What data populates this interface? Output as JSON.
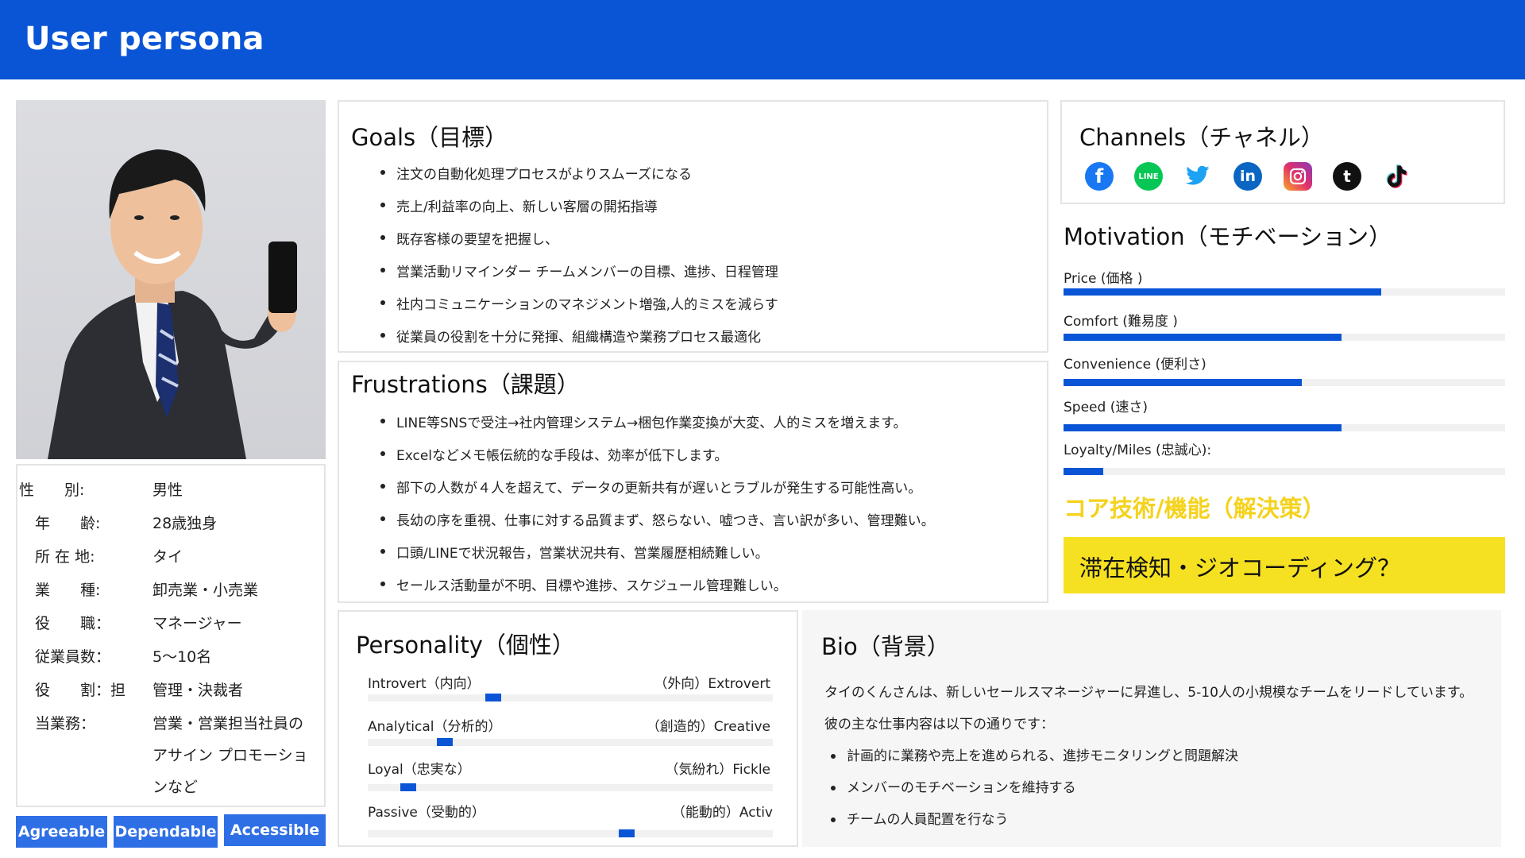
{
  "header": {
    "title": "User persona"
  },
  "profile": {
    "rows": [
      {
        "label": "性　　別:",
        "value": "男性"
      },
      {
        "label": "年　　齢:",
        "value": "28歳独身"
      },
      {
        "label": "所 在 地:",
        "value": "タイ"
      },
      {
        "label": "業　　種:",
        "value": "卸売業・小売業"
      },
      {
        "label": "役　　職：",
        "value": "マネージャー"
      },
      {
        "label": "従業員数：",
        "value": "5〜10名"
      },
      {
        "label": "役　　割：担",
        "value": "管理・決裁者"
      },
      {
        "label": "当業務：",
        "value": "営業・営業担当社員の"
      }
    ],
    "value_cont_1": "アサイン プロモーショ",
    "value_cont_2": "ンなど"
  },
  "tags": [
    "Agreeable",
    "Dependable",
    "Accessible"
  ],
  "goals": {
    "title": "Goals（目標）",
    "items": [
      "注文の自動化処理プロセスがよりスムーズになる",
      "売上/利益率の向上、新しい客層の開拓指導",
      "既存客様の要望を把握し、",
      "営業活動リマインダー チームメンバーの目標、進捗、日程管理",
      "社内コミュニケーションのマネジメント増強,人的ミスを減らす",
      "従業員の役割を十分に発揮、組織構造や業務プロセス最適化"
    ]
  },
  "frustrations": {
    "title": "Frustrations（課題）",
    "items": [
      "LINE等SNSで受注→社内管理システム→梱包作業変換が大変、人的ミスを増えます。",
      " Excelなどメモ帳伝統的な手段は、効率が低下します。",
      "部下の人数が４人を超えて、データの更新共有が遅いとラブルが発生する可能性高い。",
      "長幼の序を重視、仕事に対する品質まず、怒らない、嘘つき、言い訳が多い、管理難い。",
      "口頭/LINEで状況報告，営業状況共有、営業履歴相続難しい。",
      " セールス活動量が不明、目標や進捗、スケジュール管理難しい。"
    ]
  },
  "channels": {
    "title": "Channels（チャネル）",
    "icons": [
      {
        "name": "facebook-icon",
        "glyph": "f",
        "color": "#1877f2"
      },
      {
        "name": "line-icon",
        "glyph": "LINE",
        "color": "#06c755"
      },
      {
        "name": "twitter-icon",
        "glyph": "",
        "color": "#1da1f2"
      },
      {
        "name": "linkedin-icon",
        "glyph": "in",
        "color": "#0a66c2"
      },
      {
        "name": "instagram-icon",
        "glyph": "",
        "color": "#e1306c"
      },
      {
        "name": "tumblr-icon",
        "glyph": "t",
        "color": "#111111"
      },
      {
        "name": "tiktok-icon",
        "glyph": "♪",
        "color": "#ffffff"
      }
    ]
  },
  "motivation": {
    "title": "Motivation（モチベーション）",
    "items": [
      {
        "label": "Price (価格 )",
        "value": 0.72
      },
      {
        "label": "Comfort (難易度 )",
        "value": 0.63
      },
      {
        "label": "Convenience (便利さ)",
        "value": 0.54
      },
      {
        "label": "Speed (速さ)",
        "value": 0.63
      },
      {
        "label": "Loyalty/Miles (忠誠心):",
        "value": 0.09
      }
    ]
  },
  "core": {
    "title": "コア技術/機能（解決策）",
    "solution": "滞在検知・ジオコーディング？"
  },
  "personality": {
    "title": "Personality（個性）",
    "items": [
      {
        "left": "Introvert（内向）",
        "right": "（外向）Extrovert",
        "value": 0.29
      },
      {
        "left": "Analytical（分析的）",
        "right": "（創造的）Creative",
        "value": 0.17
      },
      {
        "left": "Loyal（忠実な）",
        "right": "（気紛れ）Fickle",
        "value": 0.08
      },
      {
        "left": "Passive（受動的）",
        "right": "（能動的）Activ",
        "value": 0.62
      }
    ]
  },
  "bio": {
    "title": "Bio（背景）",
    "paragraph": "タイのくんさんは、新しいセールスマネージャーに昇進し、5-10人の小規模なチームをリードしています。彼の主な仕事内容は以下の通りです：",
    "items": [
      "計画的に業務や売上を進められる、進捗モニタリングと問題解決",
      "メンバーのモチベーションを維持する",
      "チームの人員配置を行なう"
    ]
  }
}
